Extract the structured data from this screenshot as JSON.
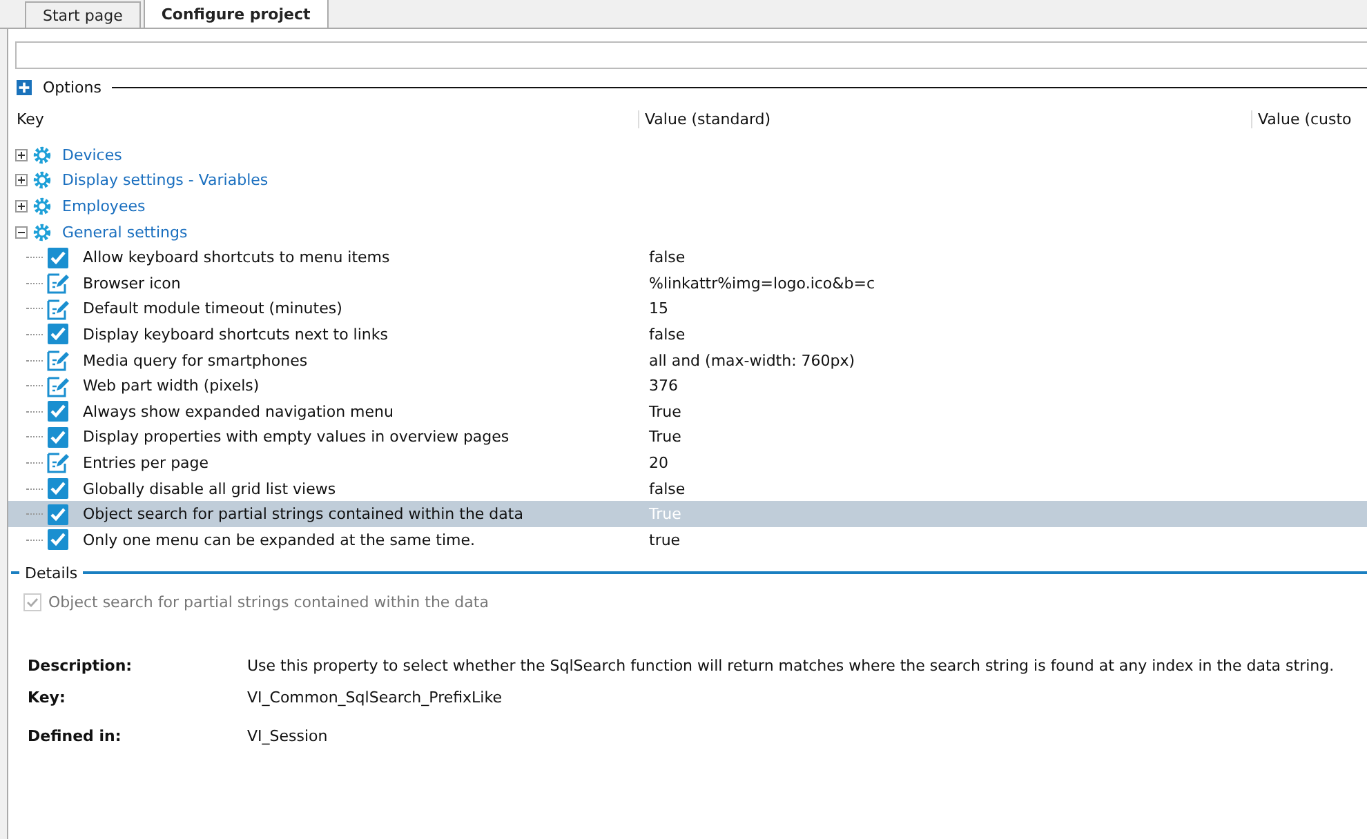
{
  "tabs": [
    {
      "label": "Start page",
      "selected": false
    },
    {
      "label": "Configure project",
      "selected": true
    }
  ],
  "options": {
    "title": "Options",
    "expanded": false
  },
  "columns": [
    "Key",
    "Value (standard)",
    "Value (custo"
  ],
  "tree": [
    {
      "label": "Devices",
      "expanded": false
    },
    {
      "label": "Display settings - Variables",
      "expanded": false
    },
    {
      "label": "Employees",
      "expanded": false
    },
    {
      "label": "General settings",
      "expanded": true,
      "children": [
        {
          "kind": "bool",
          "label": "Allow keyboard shortcuts to menu items",
          "value": "false",
          "selected": false
        },
        {
          "kind": "text",
          "label": "Browser icon",
          "value": "%linkattr%img=logo.ico&b=c",
          "selected": false
        },
        {
          "kind": "text",
          "label": "Default module timeout (minutes)",
          "value": "15",
          "selected": false
        },
        {
          "kind": "bool",
          "label": "Display keyboard shortcuts next to links",
          "value": "false",
          "selected": false
        },
        {
          "kind": "text",
          "label": "Media query for smartphones",
          "value": "all and (max-width: 760px)",
          "selected": false
        },
        {
          "kind": "text",
          "label": "Web part width (pixels)",
          "value": "376",
          "selected": false
        },
        {
          "kind": "bool",
          "label": "Always show expanded navigation menu",
          "value": "True",
          "selected": false
        },
        {
          "kind": "bool",
          "label": "Display properties with empty values in overview pages",
          "value": "True",
          "selected": false
        },
        {
          "kind": "text",
          "label": "Entries per page",
          "value": "20",
          "selected": false
        },
        {
          "kind": "bool",
          "label": "Globally disable all grid list views",
          "value": "false",
          "selected": false
        },
        {
          "kind": "bool",
          "label": "Object search for partial strings contained within the data",
          "value": "True",
          "selected": true
        },
        {
          "kind": "bool",
          "label": "Only one menu can be expanded at the same time.",
          "value": "true",
          "selected": false
        }
      ]
    }
  ],
  "details": {
    "title": "Details",
    "checkbox": {
      "label": "Object search for partial strings contained within the data",
      "checked": true,
      "disabled": true
    },
    "fields": [
      {
        "label": "Description:",
        "value": "Use this property to select whether the SqlSearch function will return matches where the search string is found at any index in the data string."
      },
      {
        "label": "Key:",
        "value": "VI_Common_SqlSearch_PrefixLike"
      },
      {
        "label": "Defined in:",
        "value": "VI_Session"
      }
    ]
  }
}
